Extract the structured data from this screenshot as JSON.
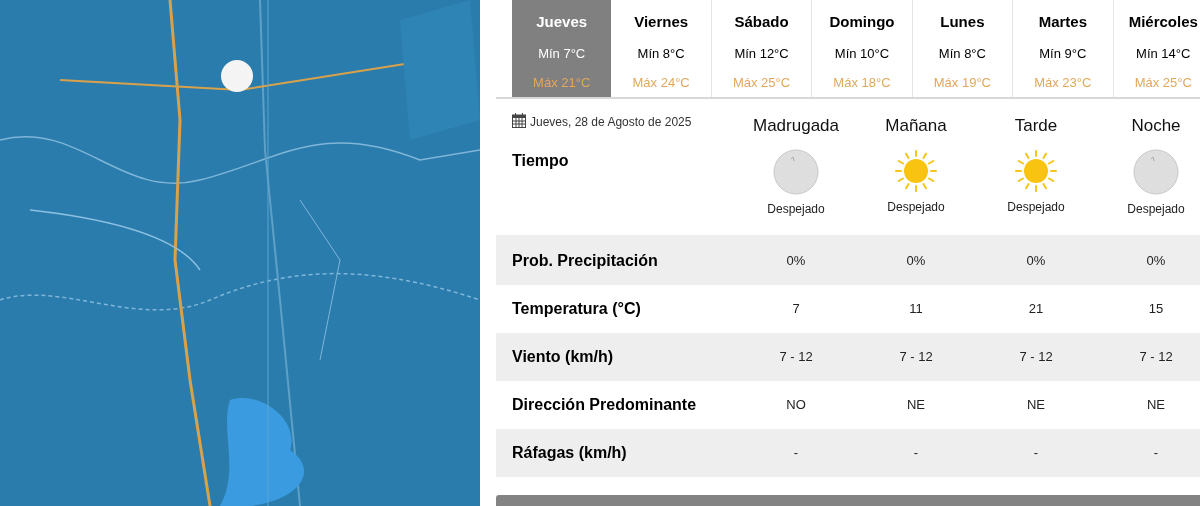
{
  "map": {
    "kind": "picture"
  },
  "days": [
    {
      "name": "Jueves",
      "min": "Mín 7°C",
      "max": "Máx 21°C",
      "selected": true
    },
    {
      "name": "Viernes",
      "min": "Mín 8°C",
      "max": "Máx 24°C",
      "selected": false
    },
    {
      "name": "Sábado",
      "min": "Mín 12°C",
      "max": "Máx 25°C",
      "selected": false
    },
    {
      "name": "Domingo",
      "min": "Mín 10°C",
      "max": "Máx 18°C",
      "selected": false
    },
    {
      "name": "Lunes",
      "min": "Mín 8°C",
      "max": "Máx 19°C",
      "selected": false
    },
    {
      "name": "Martes",
      "min": "Mín 9°C",
      "max": "Máx 23°C",
      "selected": false
    },
    {
      "name": "Miércoles",
      "min": "Mín 14°C",
      "max": "Máx 25°C",
      "selected": false
    }
  ],
  "date": "Jueves, 28 de Agosto de 2025",
  "periods": [
    "Madrugada",
    "Mañana",
    "Tarde",
    "Noche"
  ],
  "weather": {
    "label": "Tiempo",
    "items": [
      {
        "kind": "moon",
        "text": "Despejado"
      },
      {
        "kind": "sun",
        "text": "Despejado"
      },
      {
        "kind": "sun",
        "text": "Despejado"
      },
      {
        "kind": "moon",
        "text": "Despejado"
      }
    ]
  },
  "rows": [
    {
      "label": "Prob. Precipitación",
      "values": [
        "0%",
        "0%",
        "0%",
        "0%"
      ]
    },
    {
      "label": "Temperatura (°C)",
      "values": [
        "7",
        "11",
        "21",
        "15"
      ]
    },
    {
      "label": "Viento (km/h)",
      "values": [
        "7 - 12",
        "7 - 12",
        "7 - 12",
        "7 - 12"
      ]
    },
    {
      "label": "Dirección Predominante",
      "values": [
        "NO",
        "NE",
        "NE",
        "NE"
      ]
    },
    {
      "label": "Ráfagas (km/h)",
      "values": [
        "-",
        "-",
        "-",
        "-"
      ]
    }
  ]
}
